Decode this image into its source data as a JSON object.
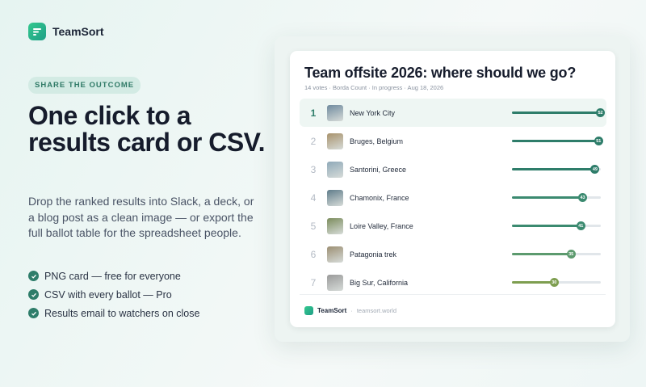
{
  "brand": {
    "name": "TeamSort"
  },
  "hero": {
    "pill": "SHARE THE OUTCOME",
    "headline": "One click to a results card or CSV.",
    "description": "Drop the ranked results into Slack, a deck, or a blog post as a clean image — or export the full ballot table for the spreadsheet people.",
    "features": [
      "PNG card — free for everyone",
      "CSV with every ballot — Pro",
      "Results email to watchers on close"
    ]
  },
  "card": {
    "title": "Team offsite 2026: where should we go?",
    "meta": "14 votes · Borda Count · In progress · Aug 18, 2026",
    "results": [
      {
        "rank": "1",
        "name": "New York City",
        "score": 52,
        "fraction": 1.0,
        "color": "#2e7d6a",
        "thumb": "#6f8a9e"
      },
      {
        "rank": "2",
        "name": "Bruges, Belgium",
        "score": 51,
        "fraction": 0.98,
        "color": "#2e7d6a",
        "thumb": "#a8926b"
      },
      {
        "rank": "3",
        "name": "Santorini, Greece",
        "score": 49,
        "fraction": 0.94,
        "color": "#2e7d6a",
        "thumb": "#8fa9b8"
      },
      {
        "rank": "4",
        "name": "Chamonix, France",
        "score": 43,
        "fraction": 0.8,
        "color": "#3b8a70",
        "thumb": "#5f7c8a"
      },
      {
        "rank": "5",
        "name": "Loire Valley, France",
        "score": 41,
        "fraction": 0.78,
        "color": "#3b8a70",
        "thumb": "#7b8c5c"
      },
      {
        "rank": "6",
        "name": "Patagonia trek",
        "score": 35,
        "fraction": 0.67,
        "color": "#5c9a6e",
        "thumb": "#9c8f73"
      },
      {
        "rank": "7",
        "name": "Big Sur, California",
        "score": 30,
        "fraction": 0.48,
        "color": "#7e9e50",
        "thumb": "#9a9a9a"
      }
    ],
    "footer": {
      "brand": "TeamSort",
      "url": "teamsort.world"
    }
  }
}
